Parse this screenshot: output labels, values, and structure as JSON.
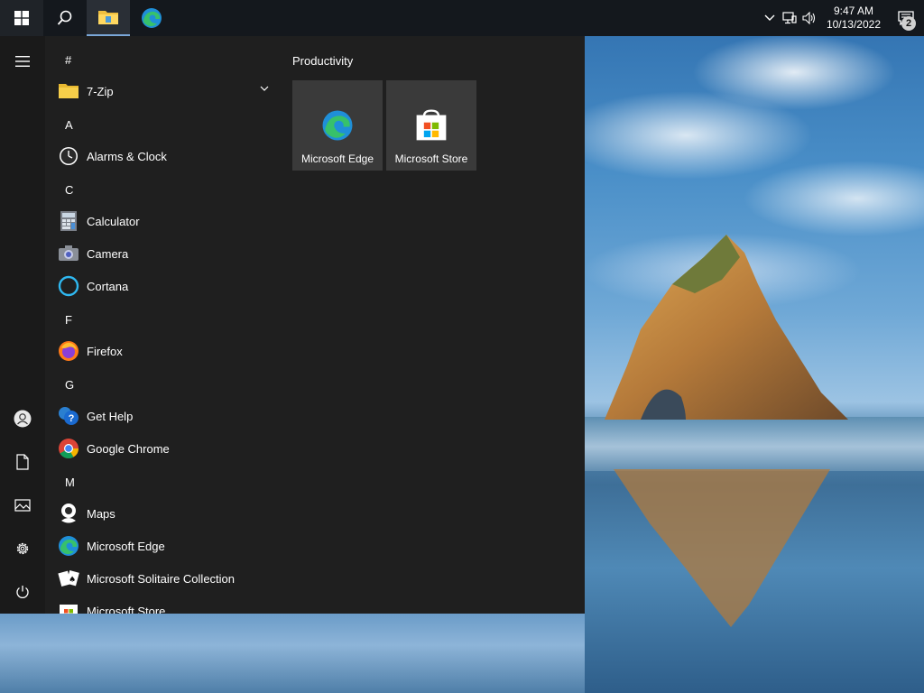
{
  "taskbar": {
    "start": "start-icon",
    "search": "search-icon",
    "file_explorer": "file-explorer-icon",
    "edge": "edge-icon",
    "tray": {
      "chevron": "chevron-up-icon",
      "network": "network-icon",
      "volume": "volume-icon",
      "time": "9:47 AM",
      "date": "10/13/2022",
      "notifications_count": "2"
    }
  },
  "start_menu": {
    "rail": [
      "menu-icon",
      "account-icon",
      "documents-icon",
      "pictures-icon",
      "settings-icon",
      "power-icon"
    ],
    "sections": {
      "hash": "#",
      "a": "A",
      "c": "C",
      "f": "F",
      "g": "G",
      "m": "M"
    },
    "apps": {
      "zip": "7-Zip",
      "alarms": "Alarms & Clock",
      "calculator": "Calculator",
      "camera": "Camera",
      "cortana": "Cortana",
      "firefox": "Firefox",
      "gethelp": "Get Help",
      "chrome": "Google Chrome",
      "maps": "Maps",
      "edge": "Microsoft Edge",
      "solitaire": "Microsoft Solitaire Collection",
      "store": "Microsoft Store"
    },
    "tiles": {
      "group": "Productivity",
      "edge": "Microsoft Edge",
      "store": "Microsoft Store"
    }
  },
  "colors": {
    "taskbar": "#14181d",
    "start_bg": "#1f1f1f",
    "tile_bg": "#3a3a3a",
    "accent": "#7aa7d8"
  }
}
